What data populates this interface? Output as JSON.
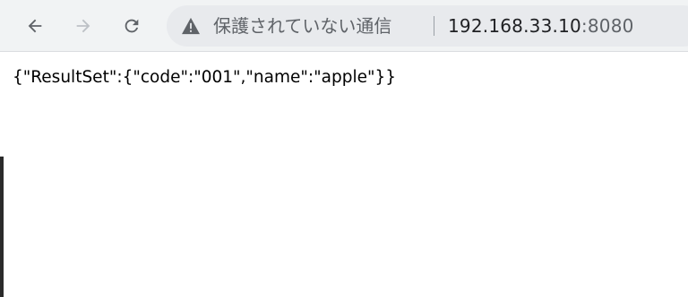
{
  "toolbar": {
    "back_icon": "arrow-left-icon",
    "forward_icon": "arrow-right-icon",
    "reload_icon": "reload-icon"
  },
  "address_bar": {
    "security_icon": "warning-triangle-icon",
    "security_label": "保護されていない通信",
    "url_host": "192.168.33.10",
    "url_port": ":8080"
  },
  "page": {
    "body_text": "{\"ResultSet\":{\"code\":\"001\",\"name\":\"apple\"}}"
  },
  "colors": {
    "toolbar_bg": "#f1f3f4",
    "omnibox_bg": "#e8eaed",
    "icon_gray": "#5f6368",
    "text_dark": "#202124"
  }
}
